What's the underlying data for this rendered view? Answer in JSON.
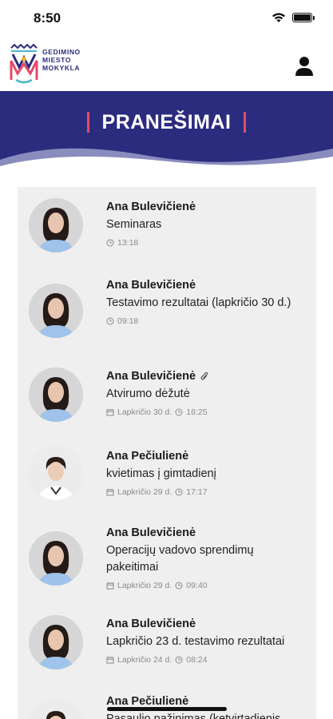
{
  "status_bar": {
    "time": "8:50"
  },
  "header": {
    "logo_lines": [
      "GEDIMINO",
      "MIESTO",
      "MOKYKLA"
    ],
    "icons": {
      "logo": "school-logo",
      "profile": "user-icon"
    }
  },
  "banner": {
    "title": "PRANEŠIMAI"
  },
  "colors": {
    "brand": "#2b2c7e",
    "accent": "#e54b6a",
    "card": "#efefef",
    "meta": "#8a8a8a"
  },
  "messages": [
    {
      "sender": "Ana Bulevičienė",
      "subject": "Seminaras",
      "date": "",
      "time": "13:18",
      "attachment": false,
      "avatar": "woman-dark-hair"
    },
    {
      "sender": "Ana Bulevičienė",
      "subject": "Testavimo rezultatai (lapkričio 30 d.)",
      "date": "",
      "time": "09:18",
      "attachment": false,
      "avatar": "woman-dark-hair"
    },
    {
      "sender": "Ana Bulevičienė",
      "subject": "Atvirumo dėžutė",
      "date": "Lapkričio 30 d.",
      "time": "16:25",
      "attachment": true,
      "avatar": "woman-dark-hair"
    },
    {
      "sender": "Ana Pečiulienė",
      "subject": "kvietimas į gimtadienį",
      "date": "Lapkričio 29 d.",
      "time": "17:17",
      "attachment": false,
      "avatar": "woman-short-hair"
    },
    {
      "sender": "Ana Bulevičienė",
      "subject": "Operacijų vadovo sprendimų pakeitimai",
      "date": "Lapkričio 29 d.",
      "time": "09:40",
      "attachment": false,
      "avatar": "woman-dark-hair"
    },
    {
      "sender": "Ana Bulevičienė",
      "subject": "Lapkričio 23 d. testavimo rezultatai",
      "date": "Lapkričio 24 d.",
      "time": "08:24",
      "attachment": false,
      "avatar": "woman-dark-hair"
    },
    {
      "sender": "Ana Pečiulienė",
      "subject": "Pasaulio pažinimas (ketvirtadienis",
      "date": "",
      "time": "",
      "attachment": false,
      "avatar": "woman-short-hair"
    }
  ]
}
